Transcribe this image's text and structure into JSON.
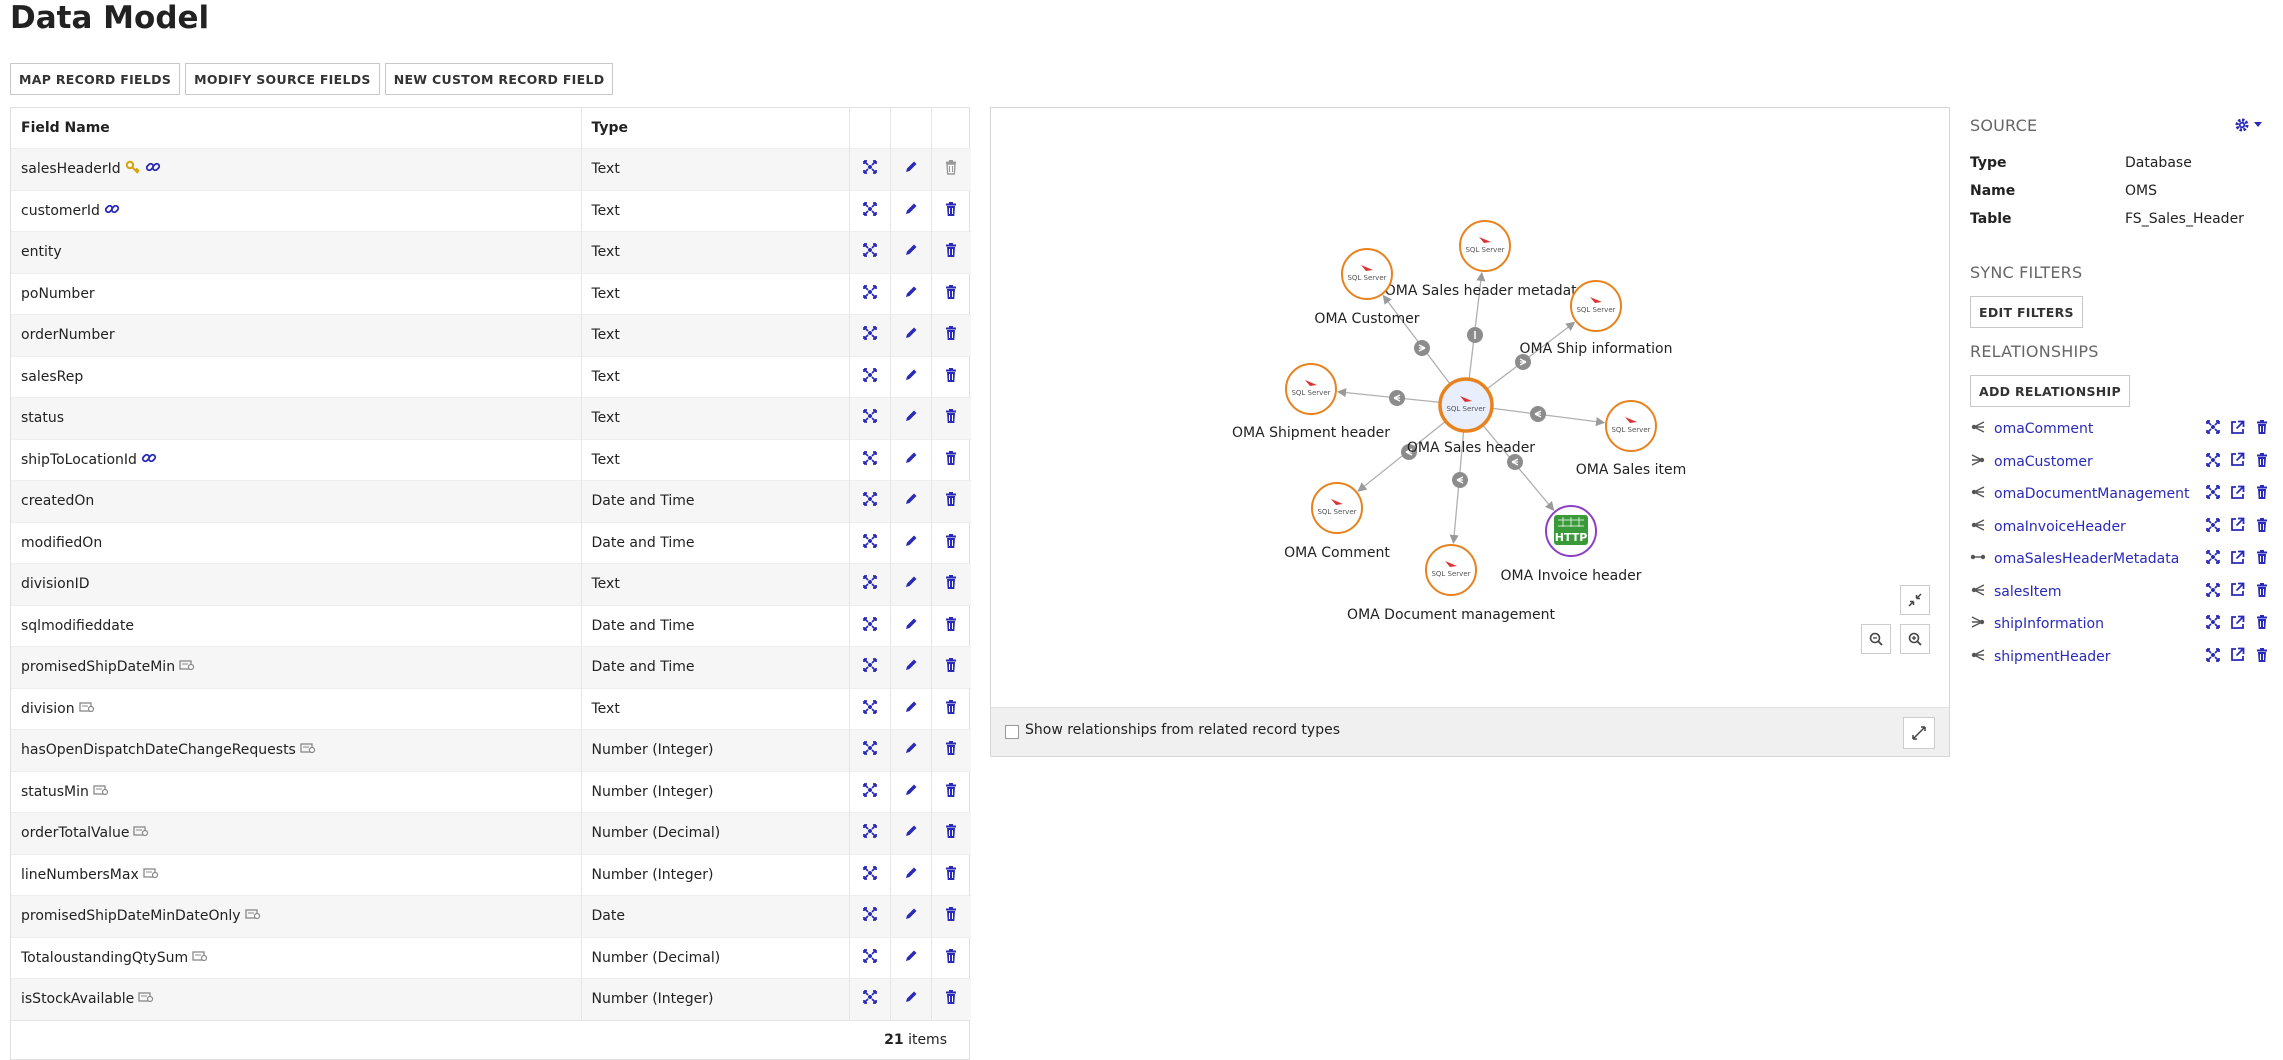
{
  "page": {
    "title": "Data Model"
  },
  "toolbar": {
    "map": "MAP RECORD FIELDS",
    "modify": "MODIFY SOURCE FIELDS",
    "newField": "NEW CUSTOM RECORD FIELD"
  },
  "grid": {
    "headers": {
      "name": "Field Name",
      "type": "Type"
    },
    "rows": [
      {
        "name": "salesHeaderId",
        "type": "Text",
        "icons": [
          "key-icon",
          "link-icon"
        ]
      },
      {
        "name": "customerId",
        "type": "Text",
        "icons": [
          "link-icon"
        ]
      },
      {
        "name": "entity",
        "type": "Text",
        "icons": []
      },
      {
        "name": "poNumber",
        "type": "Text",
        "icons": []
      },
      {
        "name": "orderNumber",
        "type": "Text",
        "icons": []
      },
      {
        "name": "salesRep",
        "type": "Text",
        "icons": []
      },
      {
        "name": "status",
        "type": "Text",
        "icons": []
      },
      {
        "name": "shipToLocationId",
        "type": "Text",
        "icons": [
          "link-icon"
        ]
      },
      {
        "name": "createdOn",
        "type": "Date and Time",
        "icons": []
      },
      {
        "name": "modifiedOn",
        "type": "Date and Time",
        "icons": []
      },
      {
        "name": "divisionID",
        "type": "Text",
        "icons": []
      },
      {
        "name": "sqlmodifieddate",
        "type": "Date and Time",
        "icons": []
      },
      {
        "name": "promisedShipDateMin",
        "type": "Date and Time",
        "icons": [
          "custom-field-icon"
        ]
      },
      {
        "name": "division",
        "type": "Text",
        "icons": [
          "custom-field-icon"
        ]
      },
      {
        "name": "hasOpenDispatchDateChangeRequests",
        "type": "Number (Integer)",
        "icons": [
          "custom-field-icon"
        ]
      },
      {
        "name": "statusMin",
        "type": "Number (Integer)",
        "icons": [
          "custom-field-icon"
        ]
      },
      {
        "name": "orderTotalValue",
        "type": "Number (Decimal)",
        "icons": [
          "custom-field-icon"
        ]
      },
      {
        "name": "lineNumbersMax",
        "type": "Number (Integer)",
        "icons": [
          "custom-field-icon"
        ]
      },
      {
        "name": "promisedShipDateMinDateOnly",
        "type": "Date",
        "icons": [
          "custom-field-icon"
        ]
      },
      {
        "name": "TotaloustandingQtySum",
        "type": "Number (Decimal)",
        "icons": [
          "custom-field-icon"
        ]
      },
      {
        "name": "isStockAvailable",
        "type": "Number (Integer)",
        "icons": [
          "custom-field-icon"
        ]
      }
    ],
    "footer": {
      "count": "21",
      "unit": "items"
    }
  },
  "graph": {
    "center": "OMA Sales header",
    "nodes": [
      {
        "label": "OMA Sales header metadata",
        "kind": "sql"
      },
      {
        "label": "OMA Customer",
        "kind": "sql"
      },
      {
        "label": "OMA Ship information",
        "kind": "sql"
      },
      {
        "label": "OMA Shipment header",
        "kind": "sql"
      },
      {
        "label": "OMA Sales item",
        "kind": "sql"
      },
      {
        "label": "OMA Comment",
        "kind": "sql"
      },
      {
        "label": "OMA Invoice header",
        "kind": "http"
      },
      {
        "label": "OMA Document management",
        "kind": "sql"
      }
    ],
    "sqlText": "SQL Server",
    "httpText": "HTTP",
    "showRelated": "Show relationships from related record types"
  },
  "source": {
    "heading": "SOURCE",
    "rows": [
      {
        "k": "Type",
        "v": "Database"
      },
      {
        "k": "Name",
        "v": "OMS"
      },
      {
        "k": "Table",
        "v": "FS_Sales_Header"
      }
    ]
  },
  "sync": {
    "heading": "SYNC FILTERS",
    "button": "EDIT FILTERS"
  },
  "relationships": {
    "heading": "RELATIONSHIPS",
    "button": "ADD RELATIONSHIP",
    "items": [
      {
        "name": "omaComment",
        "icon": "one-to-many-icon"
      },
      {
        "name": "omaCustomer",
        "icon": "many-to-one-icon"
      },
      {
        "name": "omaDocumentManagement",
        "icon": "one-to-many-icon"
      },
      {
        "name": "omaInvoiceHeader",
        "icon": "one-to-many-icon"
      },
      {
        "name": "omaSalesHeaderMetadata",
        "icon": "one-to-one-icon"
      },
      {
        "name": "salesItem",
        "icon": "one-to-many-icon"
      },
      {
        "name": "shipInformation",
        "icon": "many-to-one-icon"
      },
      {
        "name": "shipmentHeader",
        "icon": "one-to-many-icon"
      }
    ]
  },
  "colors": {
    "accent": "#2a2ab8",
    "nodeBorder": "#e8821e",
    "httpBorder": "#8a3fc4",
    "httpFill": "#3a9a3a"
  }
}
